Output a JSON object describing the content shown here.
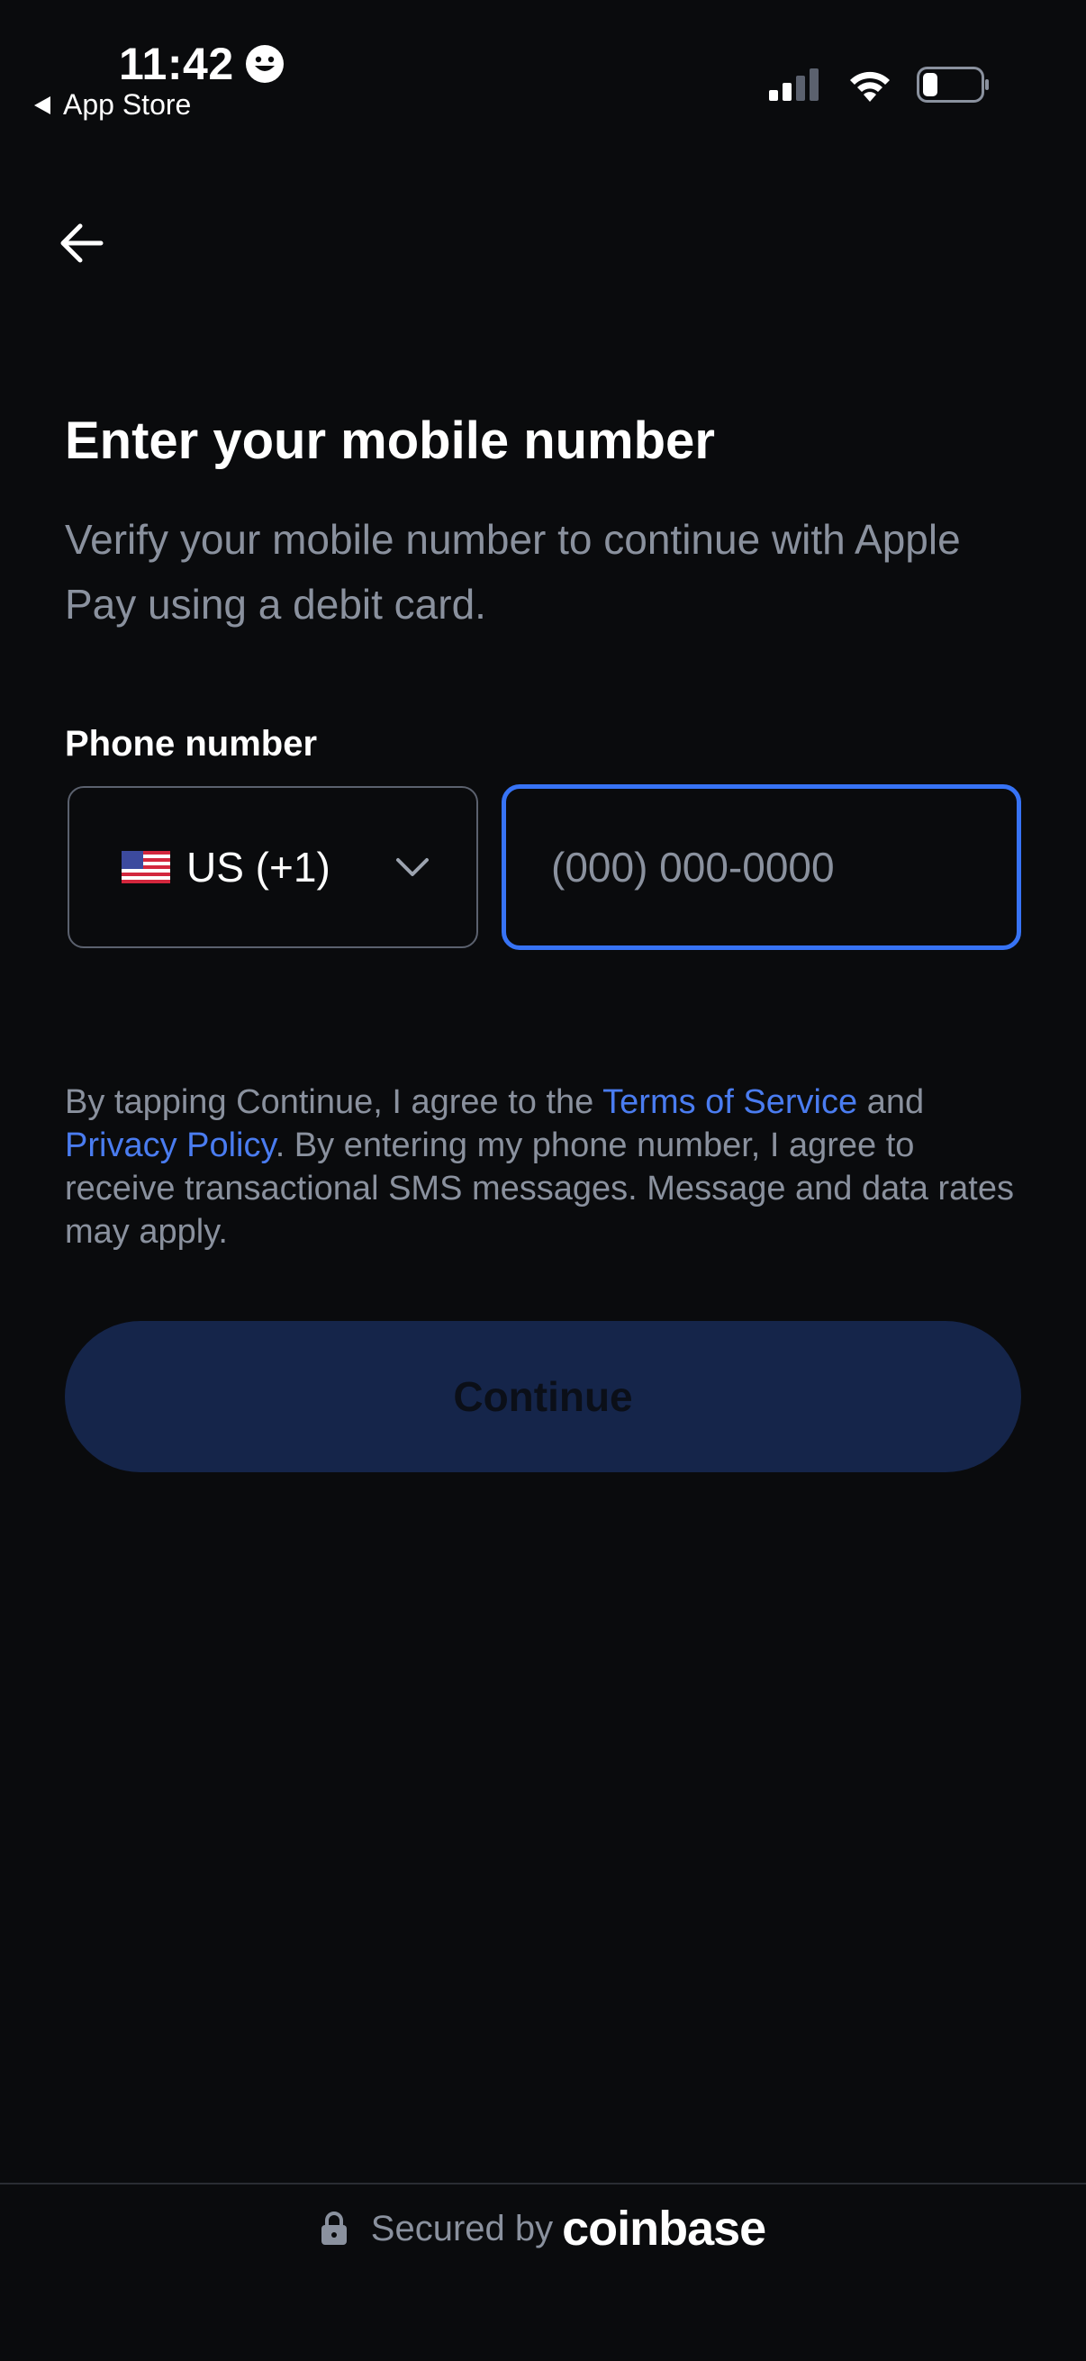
{
  "status_bar": {
    "time": "11:42",
    "back_app": "App Store"
  },
  "header": {
    "title": "Enter your mobile number",
    "subtitle": "Verify your mobile number to continue with Apple Pay using a debit card."
  },
  "phone_field": {
    "label": "Phone number",
    "country_code": "US (+1)",
    "placeholder": "(000) 000-0000",
    "value": ""
  },
  "legal": {
    "text_1": "By tapping Continue, I agree to the ",
    "terms_link": "Terms of Service",
    "text_2": " and ",
    "privacy_link": "Privacy Policy",
    "text_3": ". By entering my phone number, I agree to receive transactional SMS messages. Message and data rates may apply."
  },
  "continue_button": {
    "label": "Continue"
  },
  "footer": {
    "secured_by": "Secured by",
    "brand": "coinbase"
  },
  "colors": {
    "background": "#0a0b0d",
    "accent": "#3773f5",
    "link": "#4a7cf0",
    "muted_text": "#8a919e",
    "button_disabled": "#15254a"
  },
  "icons": [
    "smiley-icon",
    "back-triangle-icon",
    "signal-icon",
    "wifi-icon",
    "battery-icon",
    "back-arrow-icon",
    "us-flag-icon",
    "chevron-down-icon",
    "lock-icon"
  ]
}
